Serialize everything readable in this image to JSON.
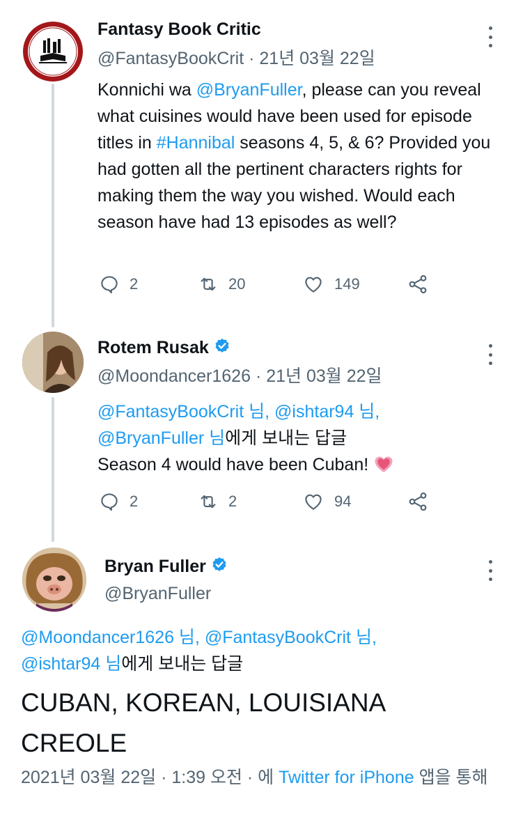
{
  "tweets": [
    {
      "name": "Fantasy Book Critic",
      "handle": "@FantasyBookCrit",
      "date": "· 21년 03월 22일",
      "body": {
        "p1": "Konnichi wa ",
        "mention": "@BryanFuller",
        "p2": ", please can you reveal what cuisines would have been used for episode titles in ",
        "hashtag": "#Hannibal",
        "p3": " seasons 4, 5, & 6? Provided you had gotten all the pertinent characters rights for making them the way you wished. Would each season have had 13 episodes as well?"
      },
      "replies": "2",
      "retweets": "20",
      "likes": "149"
    },
    {
      "name": "Rotem Rusak",
      "handle": "@Moondancer1626",
      "date": "· 21년 03월 22일",
      "reply_to": {
        "m1": "@FantasyBookCrit 님",
        "sep1": ", ",
        "m2": "@ishtar94 님",
        "sep2": ",",
        "m3": "@BryanFuller 님",
        "suffix": "에게 보내는 답글"
      },
      "body": "Season 4 would have been Cuban! ",
      "replies": "2",
      "retweets": "2",
      "likes": "94"
    },
    {
      "name": "Bryan Fuller",
      "handle": "@BryanFuller",
      "reply_to": {
        "m1": "@Moondancer1626 님",
        "sep1": ", ",
        "m2": "@FantasyBookCrit 님",
        "sep2": ",",
        "m3": "@ishtar94 님",
        "suffix": "에게 보내는 답글"
      },
      "body": "CUBAN, KOREAN, LOUISIANA CREOLE",
      "timestamp": "2021년 03월 22일 · 1:39 오전 · 에 ",
      "source": "Twitter for iPhone",
      "source_suffix": " 앱을 통해"
    }
  ],
  "icons": {
    "reply": "reply-icon",
    "retweet": "retweet-icon",
    "like": "heart-icon",
    "share": "share-icon",
    "more": "more-icon",
    "verified": "verified-badge-icon"
  },
  "colors": {
    "accent": "#1d9bf0",
    "muted": "#536471",
    "text": "#0f1419",
    "heart_emoji": "#e8557a"
  }
}
